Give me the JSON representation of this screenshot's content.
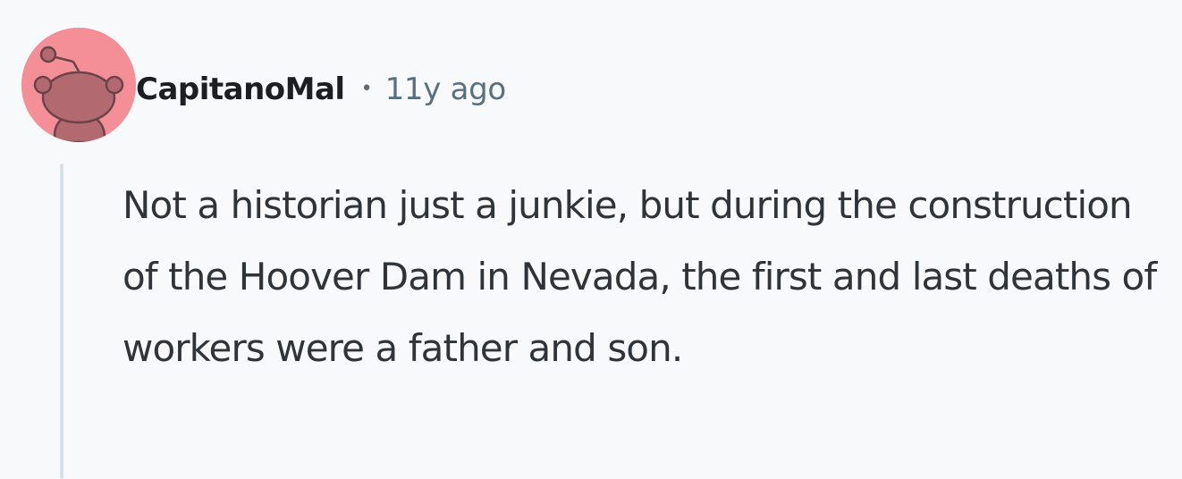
{
  "comment": {
    "avatar_icon": "reddit-default-avatar-icon",
    "username": "CapitanoMal",
    "separator": "•",
    "timestamp": "11y ago",
    "body": "Not a historian just a junkie, but during the construction of the Hoover Dam in Nevada, the first and last deaths of workers were a father and son."
  },
  "colors": {
    "background": "#f7f9fb",
    "avatar_bg": "#f58f97",
    "avatar_figure": "#b26a70",
    "thread_line": "#d8e0e8",
    "username": "#1c1f22",
    "timestamp": "#59707f",
    "body_text": "#2f3438"
  }
}
